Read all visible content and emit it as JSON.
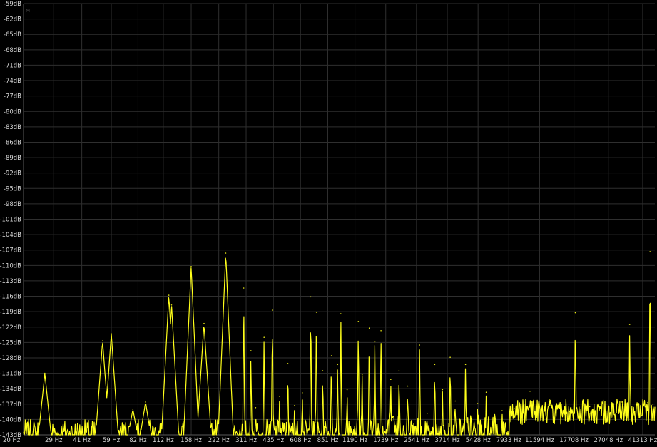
{
  "colors": {
    "background": "#000000",
    "grid": "#2f2f2f",
    "axis": "#5a5a5a",
    "trace": "#ffff1a",
    "label": "#d8d8d8"
  },
  "marker_label": "M",
  "chart_data": {
    "type": "line",
    "title": "",
    "xlabel": "",
    "ylabel": "",
    "x_scale": "log",
    "xlim": [
      20,
      48000
    ],
    "ylim": [
      -143,
      -59
    ],
    "grid": true,
    "y_ticks": [
      -59,
      -62,
      -65,
      -68,
      -71,
      -74,
      -77,
      -80,
      -83,
      -86,
      -89,
      -92,
      -95,
      -98,
      -101,
      -104,
      -107,
      -110,
      -113,
      -116,
      -119,
      -122,
      -125,
      -128,
      -131,
      -134,
      -137,
      -140,
      -143
    ],
    "y_tick_labels": [
      "-59dB",
      "-62dB",
      "-65dB",
      "-68dB",
      "-71dB",
      "-74dB",
      "-77dB",
      "-80dB",
      "-83dB",
      "-86dB",
      "-89dB",
      "-92dB",
      "-95dB",
      "-98dB",
      "-101dB",
      "-104dB",
      "-107dB",
      "-110dB",
      "-113dB",
      "-116dB",
      "-119dB",
      "-122dB",
      "-125dB",
      "-128dB",
      "-131dB",
      "-134dB",
      "-137dB",
      "-140dB",
      "-143dB"
    ],
    "x_ticks": [
      20,
      29,
      41,
      59,
      82,
      112,
      158,
      222,
      311,
      435,
      608,
      851,
      1190,
      1739,
      2541,
      3714,
      5428,
      7933,
      11594,
      17708,
      27048,
      41313
    ],
    "x_tick_labels": [
      "20 Hz",
      "29 Hz",
      "41 Hz",
      "59 Hz",
      "82 Hz",
      "112 Hz",
      "158 Hz",
      "222 Hz",
      "311 Hz",
      "435 Hz",
      "608 Hz",
      "851 Hz",
      "1190 Hz",
      "1739 Hz",
      "2541 Hz",
      "3714 Hz",
      "5428 Hz",
      "7933 Hz",
      "11594 Hz",
      "17708 Hz",
      "27048 Hz",
      "41313 Hz"
    ],
    "series": [
      {
        "color": "#ffff1a",
        "peaks": [
          {
            "x": 26,
            "y": -131
          },
          {
            "x": 53,
            "y": -124.7
          },
          {
            "x": 59,
            "y": -123.3
          },
          {
            "x": 77,
            "y": -138
          },
          {
            "x": 90,
            "y": -136.6
          },
          {
            "x": 120,
            "y": -115.8
          },
          {
            "x": 124,
            "y": -117.7
          },
          {
            "x": 158,
            "y": -110.2
          },
          {
            "x": 185,
            "y": -121.3
          },
          {
            "x": 242,
            "y": -107.6
          },
          {
            "x": 302,
            "y": -114.4
          },
          {
            "x": 330,
            "y": -126.6
          },
          {
            "x": 350,
            "y": -137.7
          },
          {
            "x": 388,
            "y": -124
          },
          {
            "x": 430,
            "y": -118.7
          },
          {
            "x": 470,
            "y": -135.5
          },
          {
            "x": 520,
            "y": -129.1
          },
          {
            "x": 565,
            "y": -137.3
          },
          {
            "x": 622,
            "y": -134.8
          },
          {
            "x": 690,
            "y": -116.1
          },
          {
            "x": 740,
            "y": -119.1
          },
          {
            "x": 800,
            "y": -130.5
          },
          {
            "x": 890,
            "y": -127.6
          },
          {
            "x": 960,
            "y": -129.3
          },
          {
            "x": 1000,
            "y": -119.4
          },
          {
            "x": 1080,
            "y": -134.2
          },
          {
            "x": 1240,
            "y": -120.9
          },
          {
            "x": 1300,
            "y": -131.3
          },
          {
            "x": 1420,
            "y": -122.2
          },
          {
            "x": 1520,
            "y": -124.9
          },
          {
            "x": 1640,
            "y": -122.7
          },
          {
            "x": 1850,
            "y": -132.2
          },
          {
            "x": 2050,
            "y": -130.5
          },
          {
            "x": 2280,
            "y": -133.5
          },
          {
            "x": 2640,
            "y": -125.5
          },
          {
            "x": 2900,
            "y": -138.8
          },
          {
            "x": 3180,
            "y": -129.3
          },
          {
            "x": 3500,
            "y": -134.2
          },
          {
            "x": 3850,
            "y": -127.9
          },
          {
            "x": 4100,
            "y": -136.4
          },
          {
            "x": 4650,
            "y": -129.3
          },
          {
            "x": 5400,
            "y": -136.9
          },
          {
            "x": 6000,
            "y": -134.7
          },
          {
            "x": 7300,
            "y": -138.3
          },
          {
            "x": 8500,
            "y": -137.9
          },
          {
            "x": 10300,
            "y": -134.5
          },
          {
            "x": 12500,
            "y": -138.3
          },
          {
            "x": 14800,
            "y": -137.6
          },
          {
            "x": 16800,
            "y": -138.5
          },
          {
            "x": 18000,
            "y": -119.2
          },
          {
            "x": 21500,
            "y": -137.5
          },
          {
            "x": 24700,
            "y": -137
          },
          {
            "x": 28800,
            "y": -137.5
          },
          {
            "x": 32000,
            "y": -136.6
          },
          {
            "x": 35200,
            "y": -121.5
          },
          {
            "x": 38500,
            "y": -137.1
          },
          {
            "x": 44000,
            "y": -136.7
          },
          {
            "x": 45200,
            "y": -107.3
          },
          {
            "x": 46800,
            "y": -137
          }
        ]
      }
    ]
  }
}
